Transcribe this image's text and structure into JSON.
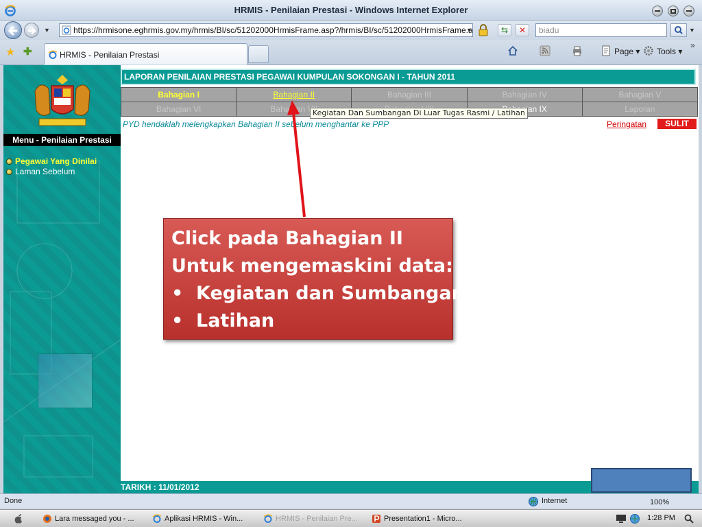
{
  "window": {
    "title": "HRMIS - Penilaian Prestasi - Windows Internet Explorer",
    "url": "https://hrmisone.eghrmis.gov.my/hrmis/BI/sc/51202000HrmisFrame.asp?/hrmis/BI/sc/51202000HrmisFrame.aspfr",
    "search_value": "biadu",
    "tab_title": "HRMIS - Penilaian Prestasi",
    "page_menu": "Page",
    "tools_menu": "Tools"
  },
  "sidebar": {
    "menu_title": "Menu - Penilaian Prestasi",
    "items": [
      {
        "label": "Pegawai Yang Dinilai"
      },
      {
        "label": "Laman Sebelum"
      }
    ]
  },
  "main": {
    "report_title": "LAPORAN PENILAIAN PRESTASI PEGAWAI KUMPULAN SOKONGAN I - TAHUN 2011",
    "tabs_row1": [
      "Bahagian I",
      "Bahagian II",
      "Bahagian III",
      "Bahagian IV",
      "Bahagian V"
    ],
    "tabs_row2": [
      "Bahagian VI",
      "Bahagian VII",
      "Bahagian VIII",
      "Bahagian IX",
      "Laporan"
    ],
    "tooltip": "Kegiatan Dan Sumbangan Di Luar Tugas Rasmi / Latihan",
    "notice": "PYD hendaklah melengkapkan Bahagian II sebelum menghantar ke PPP",
    "peringatan": "Peringatan",
    "sulit": "SULIT",
    "footer_date": "TARIKH : 11/01/2012"
  },
  "callout": {
    "line1": "Click pada Bahagian II",
    "line2": "Untuk mengemaskini data:",
    "bullet1": "Kegiatan dan Sumbangan",
    "bullet2": "Latihan",
    "bullet_char": "•"
  },
  "statusbar": {
    "status": "Done",
    "zone": "Internet",
    "zoom": "100%"
  },
  "taskbar": {
    "tasks": [
      {
        "label": "Lara messaged you - ..."
      },
      {
        "label": "Aplikasi HRMIS - Win..."
      },
      {
        "label": "HRMIS - Penilaian Pre..."
      },
      {
        "label": "Presentation1 - Micro..."
      }
    ],
    "clock": "1:28 PM"
  },
  "colors": {
    "teal": "#0a9b95",
    "callout_red": "#c0392b",
    "sulit_red": "#e11b1b",
    "active_yellow": "#ffff33",
    "arrow_red": "#e0141a"
  }
}
